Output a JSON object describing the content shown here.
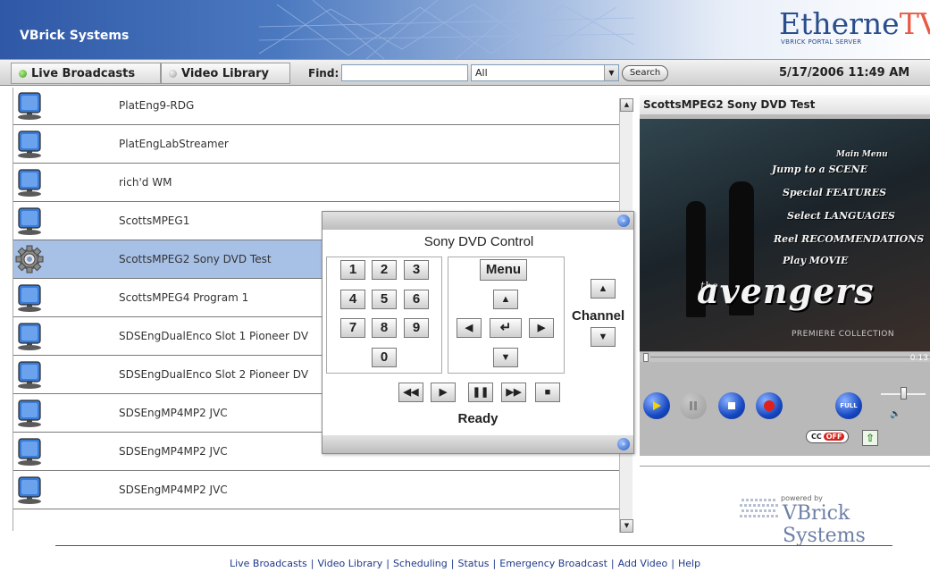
{
  "header": {
    "brand": "VBrick Systems",
    "logo_main": "Etherne",
    "logo_accent": "TV",
    "logo_subtitle": "VBRICK PORTAL SERVER"
  },
  "toolbar": {
    "tabs": [
      {
        "label": "Live Broadcasts",
        "active": true
      },
      {
        "label": "Video Library",
        "active": false
      }
    ],
    "find_label": "Find:",
    "find_value": "",
    "filter_selected": "All",
    "search_label": "Search",
    "datetime": "5/17/2006 11:49 AM"
  },
  "broadcasts": [
    {
      "name": "PlatEng9-RDG",
      "icon": "monitor-icon",
      "selected": false
    },
    {
      "name": "PlatEngLabStreamer",
      "icon": "monitor-icon",
      "selected": false
    },
    {
      "name": "rich'd WM",
      "icon": "monitor-icon",
      "selected": false
    },
    {
      "name": "ScottsMPEG1",
      "icon": "monitor-icon",
      "selected": false
    },
    {
      "name": "ScottsMPEG2 Sony DVD Test",
      "icon": "gear-icon",
      "selected": true
    },
    {
      "name": "ScottsMPEG4 Program 1",
      "icon": "monitor-icon",
      "selected": false
    },
    {
      "name": "SDSEngDualEnco Slot 1 Pioneer DV",
      "icon": "monitor-icon",
      "selected": false
    },
    {
      "name": "SDSEngDualEnco Slot 2 Pioneer DV",
      "icon": "monitor-icon",
      "selected": false
    },
    {
      "name": "SDSEngMP4MP2 JVC",
      "icon": "monitor-icon",
      "selected": false
    },
    {
      "name": "SDSEngMP4MP2 JVC",
      "icon": "monitor-icon",
      "selected": false
    },
    {
      "name": "SDSEngMP4MP2 JVC",
      "icon": "monitor-icon",
      "selected": false
    }
  ],
  "dvd_control": {
    "title": "Sony DVD Control",
    "digits": [
      "1",
      "2",
      "3",
      "4",
      "5",
      "6",
      "7",
      "8",
      "9",
      "0"
    ],
    "menu_label": "Menu",
    "channel_label": "Channel",
    "status": "Ready"
  },
  "player": {
    "title": "ScottsMPEG2 Sony DVD Test",
    "time": "0:13",
    "cc_label": "CC",
    "cc_state": "OFF",
    "full_label": "FULL",
    "dvd_menu": {
      "brand": "Main Menu",
      "items": [
        "Jump to a SCENE",
        "Special FEATURES",
        "Select LANGUAGES",
        "Reel RECOMMENDATIONS",
        "Play MOVIE"
      ],
      "title": "avengers",
      "title_prefix": "the",
      "edition": "PREMIERE COLLECTION"
    }
  },
  "powered_by": {
    "small": "powered by",
    "big": "VBrick Systems"
  },
  "footer_links": [
    "Live Broadcasts",
    "Video Library",
    "Scheduling",
    "Status",
    "Emergency Broadcast",
    "Add Video",
    "Help"
  ],
  "colors": {
    "header_blue": "#2f58a6",
    "selected_row": "#a7c0e6",
    "player_button_blue": "#1849c2",
    "logo_accent": "#e85a44"
  }
}
